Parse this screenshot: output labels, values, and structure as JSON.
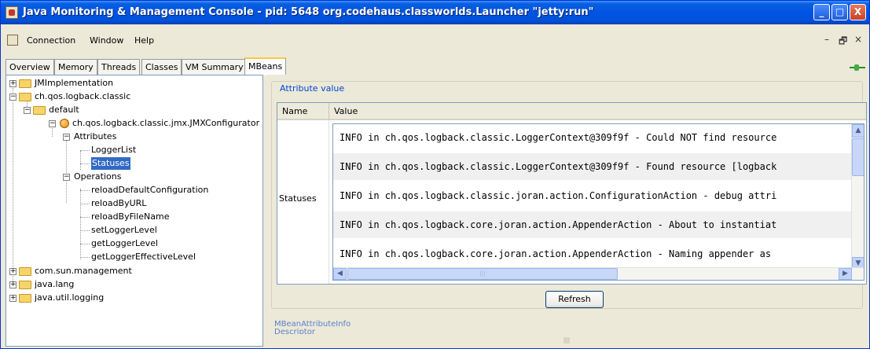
{
  "window": {
    "title": "Java Monitoring & Management Console - pid: 5648 org.codehaus.classworlds.Launcher \"jetty:run\"",
    "minimize_label": "_",
    "maximize_label": "□",
    "close_label": "X"
  },
  "menu": {
    "items": [
      "Connection",
      "Window",
      "Help"
    ],
    "mdi_minimize": "–",
    "mdi_restore": "🗗",
    "mdi_close": "×"
  },
  "tabs": [
    {
      "label": "Overview"
    },
    {
      "label": "Memory"
    },
    {
      "label": "Threads"
    },
    {
      "label": "Classes"
    },
    {
      "label": "VM Summary"
    },
    {
      "label": "MBeans",
      "active": true
    }
  ],
  "tree": {
    "nodes": [
      {
        "label": "JMImplementation",
        "level": 0,
        "expanded": false,
        "type": "folder"
      },
      {
        "label": "ch.qos.logback.classic",
        "level": 0,
        "expanded": true,
        "type": "folder"
      },
      {
        "label": "default",
        "level": 1,
        "expanded": true,
        "type": "folder"
      },
      {
        "label": "ch.qos.logback.classic.jmx.JMXConfigurator",
        "level": 2,
        "expanded": true,
        "type": "bean"
      },
      {
        "label": "Attributes",
        "level": 3,
        "expanded": true,
        "type": "group"
      },
      {
        "label": "LoggerList",
        "level": 4,
        "type": "leaf"
      },
      {
        "label": "Statuses",
        "level": 4,
        "type": "leaf",
        "selected": true
      },
      {
        "label": "Operations",
        "level": 3,
        "expanded": true,
        "type": "group"
      },
      {
        "label": "reloadDefaultConfiguration",
        "level": 4,
        "type": "leaf"
      },
      {
        "label": "reloadByURL",
        "level": 4,
        "type": "leaf"
      },
      {
        "label": "reloadByFileName",
        "level": 4,
        "type": "leaf"
      },
      {
        "label": "setLoggerLevel",
        "level": 4,
        "type": "leaf"
      },
      {
        "label": "getLoggerLevel",
        "level": 4,
        "type": "leaf"
      },
      {
        "label": "getLoggerEffectiveLevel",
        "level": 4,
        "type": "leaf"
      },
      {
        "label": "com.sun.management",
        "level": 0,
        "expanded": false,
        "type": "folder"
      },
      {
        "label": "java.lang",
        "level": 0,
        "expanded": false,
        "type": "folder"
      },
      {
        "label": "java.util.logging",
        "level": 0,
        "expanded": false,
        "type": "folder"
      }
    ]
  },
  "attribute": {
    "group_title": "Attribute value",
    "col_name": "Name",
    "col_value": "Value",
    "name": "Statuses",
    "values": [
      "INFO in ch.qos.logback.classic.LoggerContext@309f9f - Could NOT find resource",
      "INFO in ch.qos.logback.classic.LoggerContext@309f9f - Found resource [logback",
      "INFO in ch.qos.logback.classic.joran.action.ConfigurationAction - debug attri",
      "INFO in ch.qos.logback.core.joran.action.AppenderAction - About to instantiat",
      "INFO in ch.qos.logback.core.joran.action.AppenderAction - Naming appender as"
    ],
    "refresh_label": "Refresh"
  },
  "info": {
    "line1": "MBeanAttributeInfo",
    "line2": "Descriptor"
  },
  "colors": {
    "titlebar": "#0054e3",
    "selection": "#316ac5",
    "group_title": "#0046d5",
    "tab_highlight": "#ffc83c"
  }
}
